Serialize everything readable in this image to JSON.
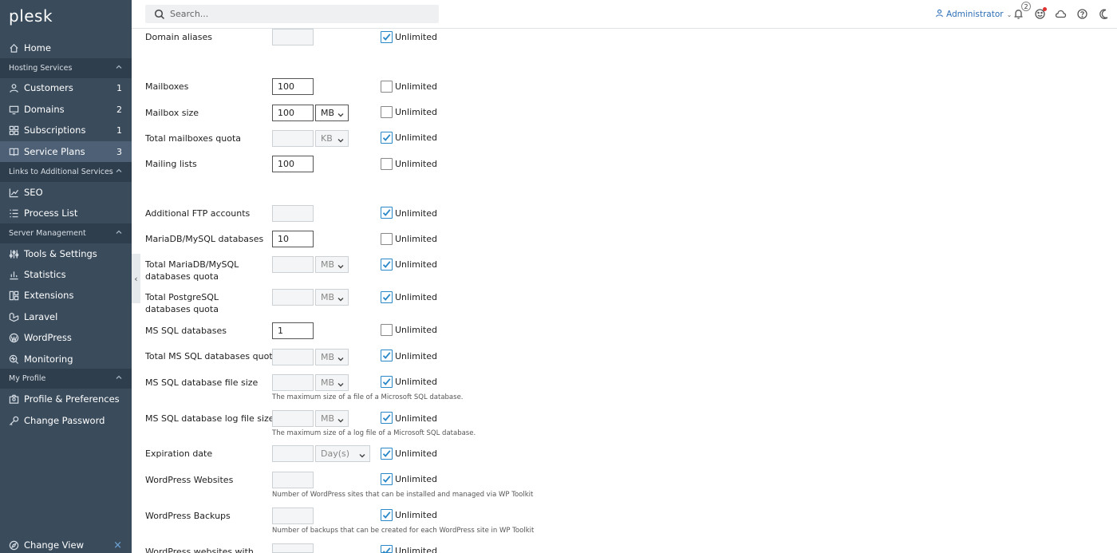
{
  "app": {
    "logo": "plesk"
  },
  "sidebar": {
    "home": "Home",
    "sections": [
      {
        "title": "Hosting Services"
      },
      {
        "title": "Links to Additional Services"
      },
      {
        "title": "Server Management"
      },
      {
        "title": "My Profile"
      }
    ],
    "items": [
      {
        "label": "Customers",
        "count": "1",
        "icon": "user-icon"
      },
      {
        "label": "Domains",
        "count": "2",
        "icon": "monitor-icon"
      },
      {
        "label": "Subscriptions",
        "count": "1",
        "icon": "grid-icon"
      },
      {
        "label": "Service Plans",
        "count": "3",
        "icon": "book-icon"
      },
      {
        "label": "SEO",
        "icon": "chart-icon"
      },
      {
        "label": "Process List",
        "icon": "list-icon"
      },
      {
        "label": "Tools & Settings",
        "icon": "sliders-icon"
      },
      {
        "label": "Statistics",
        "icon": "stats-icon"
      },
      {
        "label": "Extensions",
        "icon": "extensions-icon"
      },
      {
        "label": "Laravel",
        "icon": "laravel-icon"
      },
      {
        "label": "WordPress",
        "icon": "wordpress-icon"
      },
      {
        "label": "Monitoring",
        "icon": "monitoring-icon"
      },
      {
        "label": "Profile & Preferences",
        "icon": "profile-icon"
      },
      {
        "label": "Change Password",
        "icon": "key-icon"
      }
    ],
    "change_view": "Change View"
  },
  "topbar": {
    "search_placeholder": "Search...",
    "user": "Administrator",
    "notifications_count": "2"
  },
  "form": {
    "checkbox_label": "Unlimited",
    "rows": [
      {
        "label": "Domain aliases",
        "value": "",
        "unlimited": true
      },
      {
        "label": "Mailboxes",
        "value": "100",
        "unlimited": false
      },
      {
        "label": "Mailbox size",
        "value": "100",
        "unit": "MB",
        "unlimited": false
      },
      {
        "label": "Total mailboxes quota",
        "value": "",
        "unit": "KB",
        "unlimited": true
      },
      {
        "label": "Mailing lists",
        "value": "100",
        "unlimited": false
      },
      {
        "label": "Additional FTP accounts",
        "value": "",
        "unlimited": true
      },
      {
        "label": "MariaDB/MySQL databases",
        "value": "10",
        "unlimited": false
      },
      {
        "label": "Total MariaDB/MySQL databases quota",
        "value": "",
        "unit": "MB",
        "unlimited": true
      },
      {
        "label": "Total PostgreSQL databases quota",
        "value": "",
        "unit": "MB",
        "unlimited": true
      },
      {
        "label": "MS SQL databases",
        "value": "1",
        "unlimited": false
      },
      {
        "label": "Total MS SQL databases quota",
        "value": "",
        "unit": "MB",
        "unlimited": true
      },
      {
        "label": "MS SQL database file size",
        "value": "",
        "unit": "MB",
        "unlimited": true,
        "hint": "The maximum size of a file of a Microsoft SQL database."
      },
      {
        "label": "MS SQL database log file size",
        "value": "",
        "unit": "MB",
        "unlimited": true,
        "hint": "The maximum size of a log file of a Microsoft SQL database."
      },
      {
        "label": "Expiration date",
        "value": "",
        "unit": "Day(s)",
        "unlimited": true
      },
      {
        "label": "WordPress Websites",
        "value": "",
        "unlimited": true,
        "hint": "Number of WordPress sites that can be installed and managed via WP Toolkit"
      },
      {
        "label": "WordPress Backups",
        "value": "",
        "unlimited": true,
        "hint": "Number of backups that can be created for each WordPress site in WP Toolkit"
      },
      {
        "label": "WordPress websites with",
        "value": "",
        "unlimited": true
      }
    ]
  }
}
